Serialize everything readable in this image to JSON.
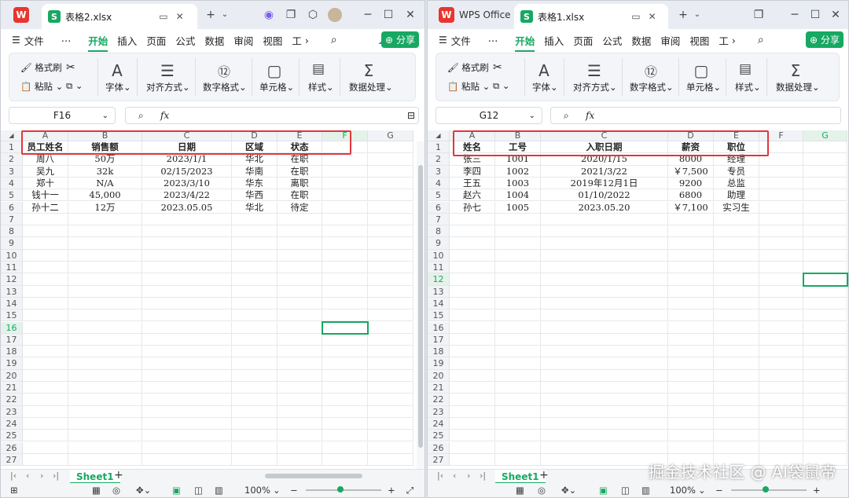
{
  "left": {
    "app_logo": "W",
    "tab_title": "表格2.xlsx",
    "menu": [
      "文件",
      "⋯",
      "开始",
      "插入",
      "页面",
      "公式",
      "数据",
      "审阅",
      "视图",
      "工"
    ],
    "active_menu": "开始",
    "share_label": "分享",
    "ribbon": {
      "format_painter": "格式刷",
      "paste": "粘贴",
      "font": "字体",
      "align": "对齐方式",
      "number": "数字格式",
      "cell": "单元格",
      "style": "样式",
      "data": "数据处理"
    },
    "namebox": "F16",
    "fx": "fx",
    "columns": [
      "A",
      "B",
      "C",
      "D",
      "E",
      "F",
      "G"
    ],
    "rows": [
      [
        "员工姓名",
        "销售额",
        "日期",
        "区域",
        "状态"
      ],
      [
        "周八",
        "50万",
        "2023/1/1",
        "华北",
        "在职"
      ],
      [
        "吴九",
        "32k",
        "02/15/2023",
        "华南",
        "在职"
      ],
      [
        "郑十",
        "N/A",
        "2023/3/10",
        "华东",
        "离职"
      ],
      [
        "钱十一",
        "45,000",
        "2023/4/22",
        "华西",
        "在职"
      ],
      [
        "孙十二",
        "12万",
        "2023.05.05",
        "华北",
        "待定"
      ]
    ],
    "row_numbers": [
      "1",
      "2",
      "3",
      "4",
      "5",
      "6",
      "7",
      "8",
      "9",
      "10",
      "11",
      "12",
      "13",
      "14",
      "15",
      "16",
      "17",
      "18",
      "19",
      "20",
      "21",
      "22",
      "23",
      "24",
      "25",
      "26",
      "27"
    ],
    "sheet_tab": "Sheet1",
    "add_sheet": "+",
    "zoom": "100%"
  },
  "right": {
    "app_logo": "W",
    "app_name": "WPS Office",
    "tab_title": "表格1.xlsx",
    "menu": [
      "文件",
      "⋯",
      "开始",
      "插入",
      "页面",
      "公式",
      "数据",
      "审阅",
      "视图",
      "工"
    ],
    "active_menu": "开始",
    "share_label": "分享",
    "ribbon": {
      "format_painter": "格式刷",
      "paste": "粘贴",
      "font": "字体",
      "align": "对齐方式",
      "number": "数字格式",
      "cell": "单元格",
      "style": "样式",
      "data": "数据处理"
    },
    "namebox": "G12",
    "fx": "fx",
    "columns": [
      "A",
      "B",
      "C",
      "D",
      "E",
      "F",
      "G"
    ],
    "rows": [
      [
        "姓名",
        "工号",
        "入职日期",
        "薪资",
        "职位"
      ],
      [
        "张三",
        "1001",
        "2020/1/15",
        "8000",
        "经理"
      ],
      [
        "李四",
        "1002",
        "2021/3/22",
        "￥7,500",
        "专员"
      ],
      [
        "王五",
        "1003",
        "2019年12月1日",
        "9200",
        "总监"
      ],
      [
        "赵六",
        "1004",
        "01/10/2022",
        "6800",
        "助理"
      ],
      [
        "孙七",
        "1005",
        "2023.05.20",
        "￥7,100",
        "实习生"
      ]
    ],
    "row_numbers": [
      "1",
      "2",
      "3",
      "4",
      "5",
      "6",
      "7",
      "8",
      "9",
      "10",
      "11",
      "12",
      "13",
      "14",
      "15",
      "16",
      "17",
      "18",
      "19",
      "20",
      "21",
      "22",
      "23",
      "24",
      "25",
      "26",
      "27"
    ],
    "sheet_tab": "Sheet1",
    "add_sheet": "+",
    "zoom": "100%"
  },
  "watermark": "掘金技术社区 @ AI袋鼠帝"
}
